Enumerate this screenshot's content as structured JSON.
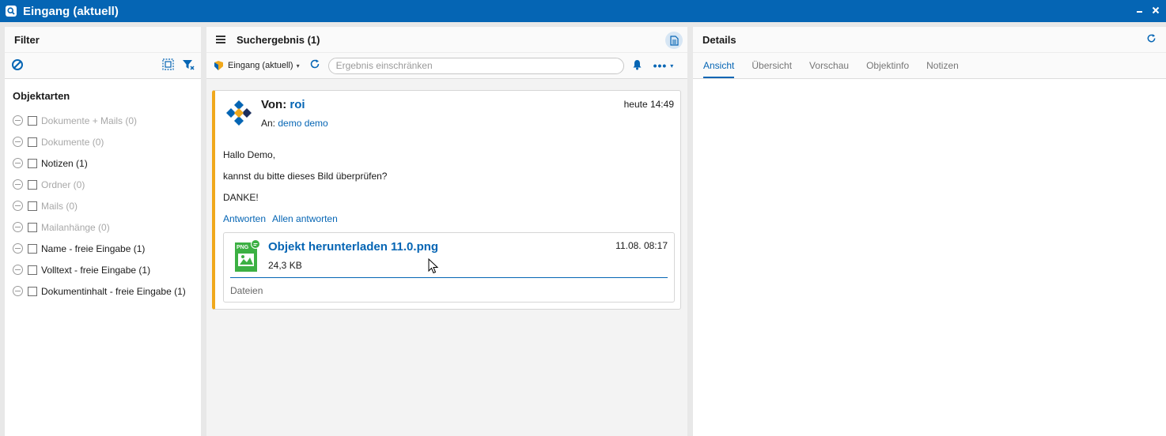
{
  "window": {
    "title": "Eingang (aktuell)"
  },
  "filter": {
    "title": "Filter",
    "section_title": "Objektarten",
    "items": [
      {
        "label": "Dokumente + Mails (0)",
        "enabled": false
      },
      {
        "label": "Dokumente (0)",
        "enabled": false
      },
      {
        "label": "Notizen (1)",
        "enabled": true
      },
      {
        "label": "Ordner (0)",
        "enabled": false
      },
      {
        "label": "Mails (0)",
        "enabled": false
      },
      {
        "label": "Mailanhänge (0)",
        "enabled": false
      },
      {
        "label": "Name - freie Eingabe (1)",
        "enabled": true
      },
      {
        "label": "Volltext - freie Eingabe (1)",
        "enabled": true
      },
      {
        "label": "Dokumentinhalt - freie Eingabe (1)",
        "enabled": true
      }
    ]
  },
  "result": {
    "title": "Suchergebnis (1)",
    "source": "Eingang (aktuell)",
    "search_placeholder": "Ergebnis einschränken",
    "mail": {
      "from_label": "Von:",
      "from": "roi",
      "to_label": "An:",
      "to": "demo demo",
      "time": "heute 14:49",
      "body": [
        "Hallo Demo,",
        "kannst du bitte dieses Bild überprüfen?",
        "DANKE!"
      ],
      "reply": "Antworten",
      "reply_all": "Allen antworten",
      "attachment": {
        "name": "Objekt herunterladen 11.0.png",
        "size": "24,3 KB",
        "date": "11.08. 08:17",
        "footer": "Dateien",
        "icon_badge": "PNG"
      }
    }
  },
  "details": {
    "title": "Details",
    "tabs": [
      "Ansicht",
      "Übersicht",
      "Vorschau",
      "Objektinfo",
      "Notizen"
    ],
    "active_tab": 0
  },
  "colors": {
    "accent": "#0565b4",
    "card_stripe": "#f0a81c",
    "file_icon": "#3cb043"
  }
}
